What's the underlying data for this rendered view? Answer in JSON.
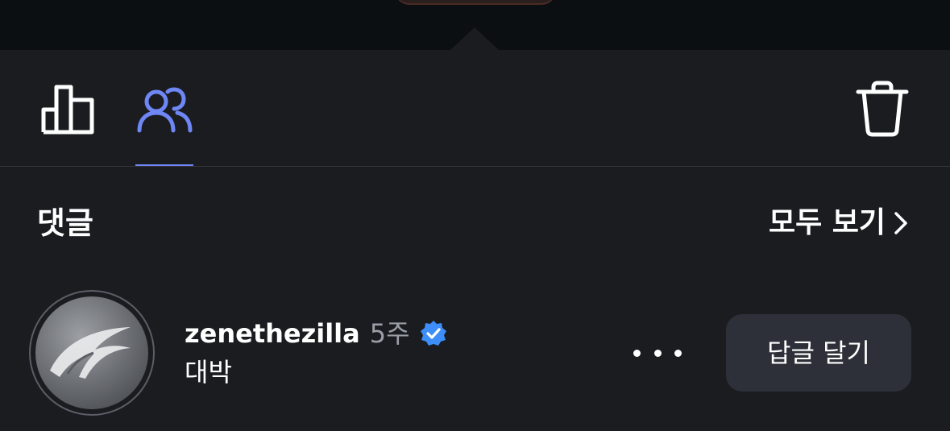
{
  "tabs": [
    {
      "id": "insights",
      "icon": "bar-chart-icon",
      "active": false
    },
    {
      "id": "viewers",
      "icon": "people-icon",
      "active": true
    }
  ],
  "actions": {
    "delete_icon": "trash-icon"
  },
  "comments_section": {
    "title": "댓글",
    "see_all_label": "모두 보기",
    "see_all_icon": "chevron-right-icon"
  },
  "comment": {
    "username": "zenethezilla",
    "time_ago": "5주",
    "verified": true,
    "text": "대박",
    "reply_label": "답글 달기",
    "more_icon": "more-horizontal-icon"
  },
  "colors": {
    "background": "#1a1c20",
    "top_background": "#0c0f12",
    "accent": "#6f86f5",
    "verified": "#3d8ef8",
    "reply_button": "#2d3038"
  }
}
